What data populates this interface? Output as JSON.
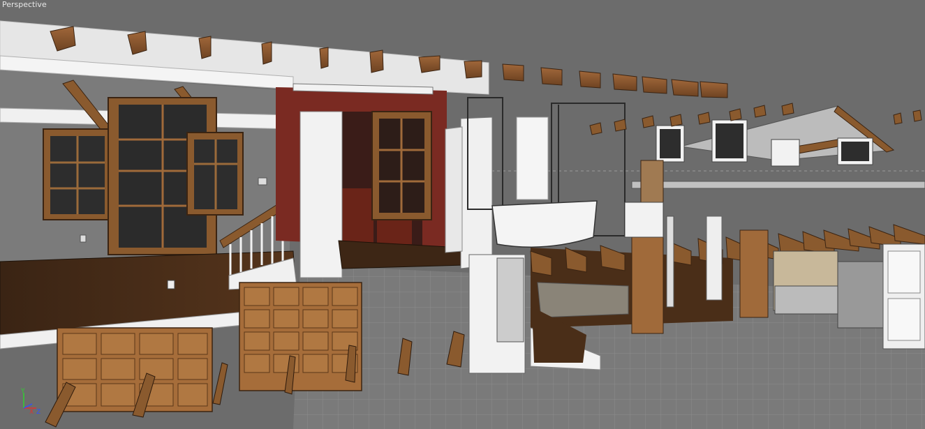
{
  "viewport": {
    "label": "Perspective",
    "background": "#6d6d6d",
    "grid_color": "#8a8a8a",
    "floor_color": "#7b7b7b"
  },
  "axis": {
    "x_label": "X",
    "y_label": "Y",
    "z_label": "Z",
    "x_color": "#e03030",
    "y_color": "#30d030",
    "z_color": "#3050ff"
  },
  "model": {
    "wood_color": "#8a5a2e",
    "dark_wood_color": "#4a2e18",
    "wall_color": "#7a7a7a",
    "white_color": "#f2f2f2",
    "red_color": "#7a2a22",
    "floor_wood_color": "#3d2615"
  }
}
